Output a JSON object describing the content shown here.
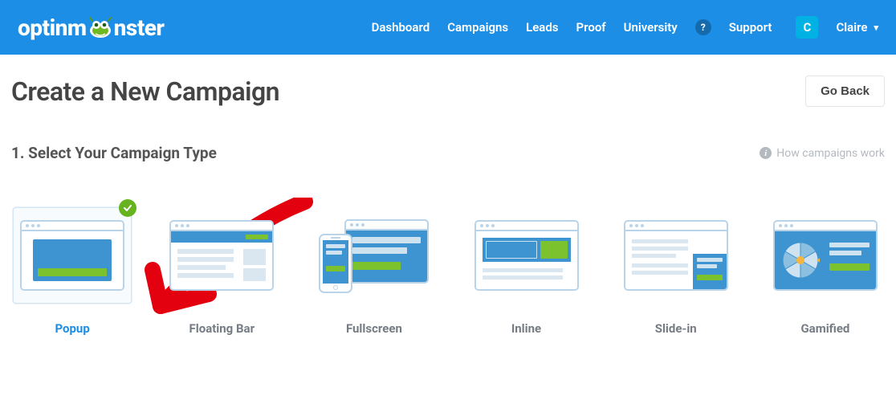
{
  "brand": "optinmonster",
  "nav": {
    "dashboard": "Dashboard",
    "campaigns": "Campaigns",
    "leads": "Leads",
    "proof": "Proof",
    "university": "University",
    "support": "Support"
  },
  "user": {
    "initial": "C",
    "name": "Claire"
  },
  "page_title": "Create a New Campaign",
  "go_back": "Go Back",
  "section": {
    "title": "1. Select Your Campaign Type",
    "help": "How campaigns work"
  },
  "types": {
    "popup": "Popup",
    "floating_bar": "Floating Bar",
    "fullscreen": "Fullscreen",
    "inline": "Inline",
    "slidein": "Slide-in",
    "gamified": "Gamified"
  }
}
